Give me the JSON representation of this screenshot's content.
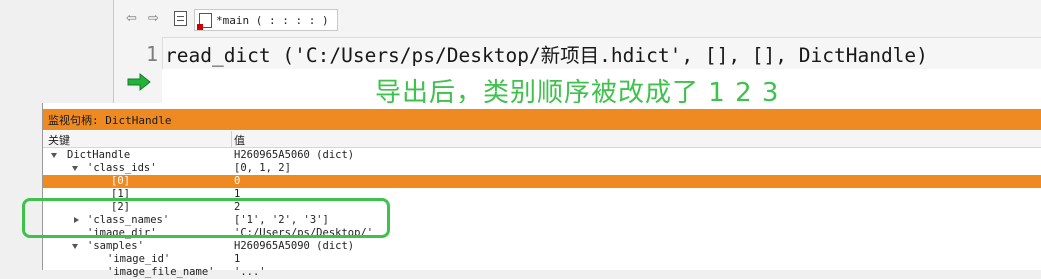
{
  "toolbar": {
    "back_icon": "⇦",
    "forward_icon": "⇨",
    "tab_label": "*main ( : : : : )"
  },
  "editor": {
    "line_number": "1",
    "code": "read_dict ('C:/Users/ps/Desktop/新项目.hdict', [], [], DictHandle)",
    "annotation": "导出后，类别顺序被改成了 1  2 3"
  },
  "watch": {
    "title": "监视句柄: DictHandle",
    "col_key": "关键",
    "col_value": "值",
    "rows": [
      {
        "key": "DictHandle",
        "value": "H260965A5060 (dict)"
      },
      {
        "key": "'class_ids'",
        "value": "[0, 1, 2]"
      },
      {
        "key": "[0]",
        "value": "0"
      },
      {
        "key": "[1]",
        "value": "1"
      },
      {
        "key": "[2]",
        "value": "2"
      },
      {
        "key": "'class_names'",
        "value": "['1', '2', '3']"
      },
      {
        "key": "'image_dir'",
        "value": "'C:/Users/ps/Desktop/'"
      },
      {
        "key": "'samples'",
        "value": "H260965A5090 (dict)"
      },
      {
        "key": "'image_id'",
        "value": "1"
      },
      {
        "key": "'image_file_name'",
        "value": "'...'"
      }
    ]
  },
  "colors": {
    "accent_orange": "#ee8a21",
    "annotation_green": "#3ec24c"
  }
}
